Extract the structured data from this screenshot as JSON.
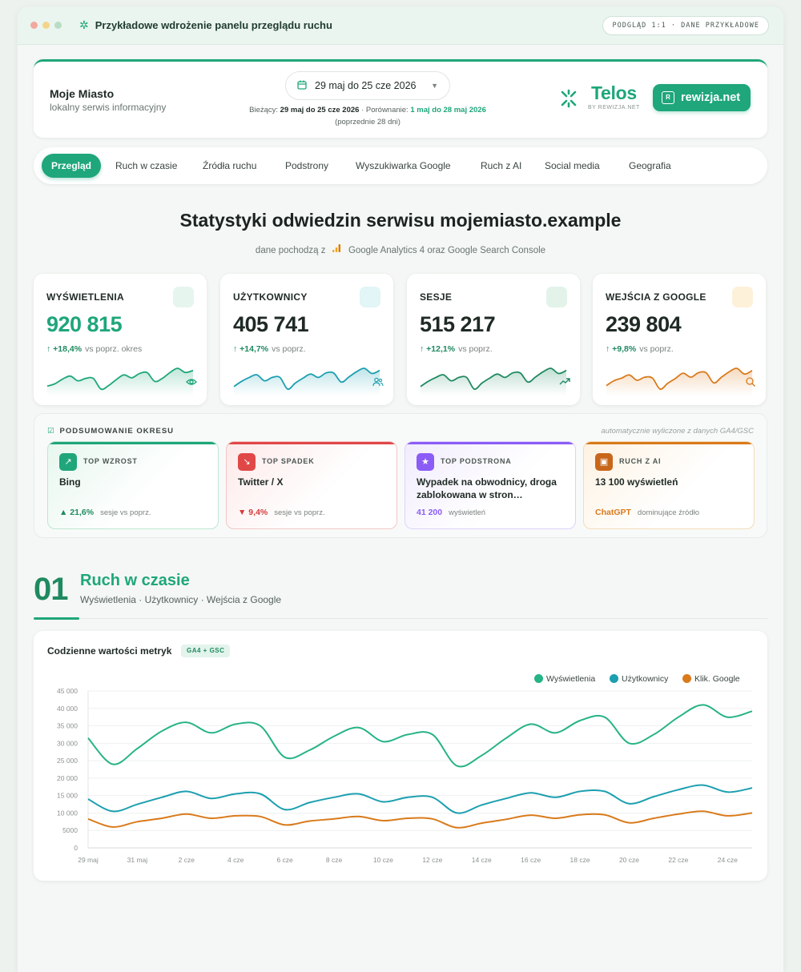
{
  "window": {
    "title": "Przykładowe wdrożenie panelu przeglądu ruchu",
    "badge": "PODGLĄD 1:1 · DANE PRZYKŁADOWE"
  },
  "header": {
    "site_name": "Moje Miasto",
    "site_sub": "lokalny serwis informacyjny",
    "date_range": "29 maj do 25 cze 2026",
    "current_label": "Bieżący:",
    "current_value": "29 maj do 25 cze 2026",
    "compare_label": "· Porównanie:",
    "compare_value": "1 maj do 28 maj 2026",
    "compare_note": "(poprzednie 28 dni)",
    "brand_name": "Telos",
    "brand_by": "BY REWIZJA.NET",
    "partner_button": "rewizja.net"
  },
  "tabs": [
    {
      "label": "Przegląd",
      "active": true
    },
    {
      "label": "Ruch w czasie"
    },
    {
      "label": "Źródła ruchu"
    },
    {
      "label": "Podstrony"
    },
    {
      "label": "Wyszukiwarka Google"
    },
    {
      "label": "Ruch z AI"
    },
    {
      "label": "Social media"
    },
    {
      "label": "Geografia"
    }
  ],
  "hero": {
    "title": "Statystyki odwiedzin serwisu mojemiasto.example",
    "sub_prefix": "dane pochodzą z",
    "sub_source": "Google Analytics 4 oraz Google Search Console"
  },
  "kpis": [
    {
      "label": "WYŚWIETLENIA",
      "value": "920 815",
      "delta": "↑ +18,4%",
      "delta_note": "vs poprz. okres",
      "color": "#1fa67a",
      "icon": "eye-icon"
    },
    {
      "label": "UŻYTKOWNICY",
      "value": "405 741",
      "delta": "↑ +14,7%",
      "delta_note": "vs poprz.",
      "color": "#1c9fb0",
      "icon": "users-icon"
    },
    {
      "label": "SESJE",
      "value": "515 217",
      "delta": "↑ +12,1%",
      "delta_note": "vs poprz.",
      "color": "#1f8a60",
      "icon": "trend-up-icon"
    },
    {
      "label": "WEJŚCIA Z GOOGLE",
      "value": "239 804",
      "delta": "↑ +9,8%",
      "delta_note": "vs poprz.",
      "color": "#d97a1b",
      "icon": "search-icon"
    }
  ],
  "summary": {
    "title": "PODSUMOWANIE OKRESU",
    "note": "automatycznie wyliczone z danych GA4/GSC",
    "cards": [
      {
        "label": "TOP WZROST",
        "value": "Bing",
        "stat": "▲ 21,6%",
        "stat_note": "sesje vs poprz.",
        "color": "#1fa67a"
      },
      {
        "label": "TOP SPADEK",
        "value": "Twitter / X",
        "stat": "▼ 9,4%",
        "stat_note": "sesje vs poprz.",
        "color": "#e04848"
      },
      {
        "label": "TOP PODSTRONA",
        "value": "Wypadek na obwodnicy, droga zablokowana w stron…",
        "stat": "41 200",
        "stat_note": "wyświetleń",
        "color": "#8b5cf6"
      },
      {
        "label": "RUCH Z AI",
        "value": "13 100 wyświetleń",
        "stat": "ChatGPT",
        "stat_note": "dominujące źródło",
        "color": "#d97a1b"
      }
    ]
  },
  "section": {
    "number": "01",
    "title": "Ruch w czasie",
    "subtitle": "Wyświetlenia · Użytkownicy · Wejścia z Google"
  },
  "chart_card": {
    "title": "Codzienne wartości metryk",
    "badge": "GA4 + GSC"
  },
  "chart_data": {
    "type": "line",
    "x": [
      "29 maj",
      "30 maj",
      "31 maj",
      "1 cze",
      "2 cze",
      "3 cze",
      "4 cze",
      "5 cze",
      "6 cze",
      "7 cze",
      "8 cze",
      "9 cze",
      "10 cze",
      "11 cze",
      "12 cze",
      "13 cze",
      "14 cze",
      "15 cze",
      "16 cze",
      "17 cze",
      "18 cze",
      "19 cze",
      "20 cze",
      "21 cze",
      "22 cze",
      "23 cze",
      "24 cze",
      "25 cze"
    ],
    "tick_labels": [
      "29 maj",
      "31 maj",
      "2 cze",
      "4 cze",
      "6 cze",
      "8 cze",
      "10 cze",
      "12 cze",
      "14 cze",
      "16 cze",
      "18 cze",
      "20 cze",
      "22 cze",
      "24 cze"
    ],
    "y_ticks": [
      "0",
      "5000",
      "10 000",
      "15 000",
      "20 000",
      "25 000",
      "30 000",
      "35 000",
      "40 000",
      "45 000"
    ],
    "ylim": [
      0,
      45000
    ],
    "grid": true,
    "legend_position": "top-right",
    "series": [
      {
        "name": "Wyświetlenia",
        "color": "#26b386",
        "values": [
          31500,
          24000,
          28500,
          33500,
          36000,
          33000,
          35500,
          35000,
          26000,
          28000,
          32000,
          34500,
          30500,
          32500,
          32500,
          23500,
          26500,
          31500,
          35500,
          33000,
          36500,
          37500,
          30000,
          32500,
          37500,
          41000,
          37500,
          39200
        ]
      },
      {
        "name": "Użytkownicy",
        "color": "#1c9fb0",
        "values": [
          14000,
          10500,
          12500,
          14500,
          16200,
          14200,
          15500,
          15500,
          11000,
          13000,
          14500,
          15500,
          13200,
          14500,
          14500,
          10000,
          12300,
          14200,
          15800,
          14500,
          16200,
          16200,
          12700,
          14700,
          16700,
          18000,
          16000,
          17200
        ]
      },
      {
        "name": "Klik. Google",
        "color": "#d97a1b",
        "values": [
          8300,
          6000,
          7500,
          8500,
          9700,
          8500,
          9200,
          9000,
          6600,
          7700,
          8300,
          9000,
          7800,
          8500,
          8300,
          5800,
          7100,
          8200,
          9400,
          8500,
          9500,
          9500,
          7200,
          8500,
          9700,
          10500,
          9200,
          10000
        ]
      }
    ]
  },
  "colors": {
    "accent": "#1fa67a",
    "background": "#f4f7f5"
  }
}
